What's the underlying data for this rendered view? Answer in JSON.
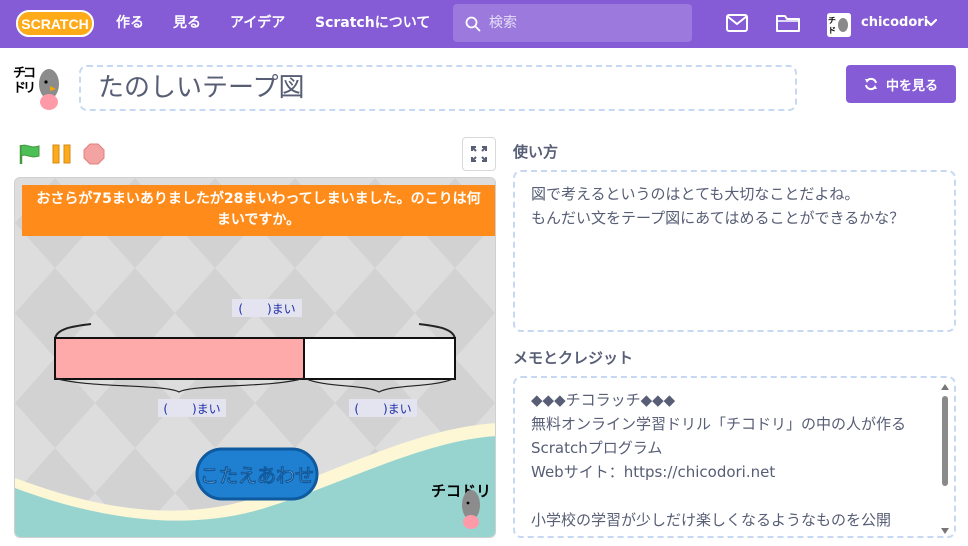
{
  "header": {
    "logo_text": "SCRATCH",
    "nav": [
      "作る",
      "見る",
      "アイデア",
      "Scratchについて"
    ],
    "search_placeholder": "検索",
    "username": "chicodori"
  },
  "project": {
    "title": "たのしいテープ図",
    "see_inside_label": "中を見る"
  },
  "stage": {
    "question": "おさらが75まいありましたが28まいわってしまいました。のこりは何まいですか。",
    "label_top": "(　　)まい",
    "label_left": "(　　)まい",
    "label_right": "(　　)まい",
    "answer_button": "こたえあわせ",
    "watermark_text": "チコドリ"
  },
  "instructions": {
    "heading": "使い方",
    "text": "図で考えるというのはとても大切なことだよね。\nもんだい文をテープ図にあてはめることができるかな？"
  },
  "notes": {
    "heading": "メモとクレジット",
    "text": "◆◆◆チコラッチ◆◆◆\n無料オンライン学習ドリル「チコドリ」の中の人が作るScratchプログラム\nWebサイト：https://chicodori.net\n\n小学校の学習が少しだけ楽しくなるようなものを公開"
  },
  "colors": {
    "header_bg": "#855cd6",
    "question_bg": "#ff8c1a",
    "tape_left": "#ffaaaa",
    "tape_right": "#ffffff",
    "answer_button_bg": "#1f7fd1"
  }
}
